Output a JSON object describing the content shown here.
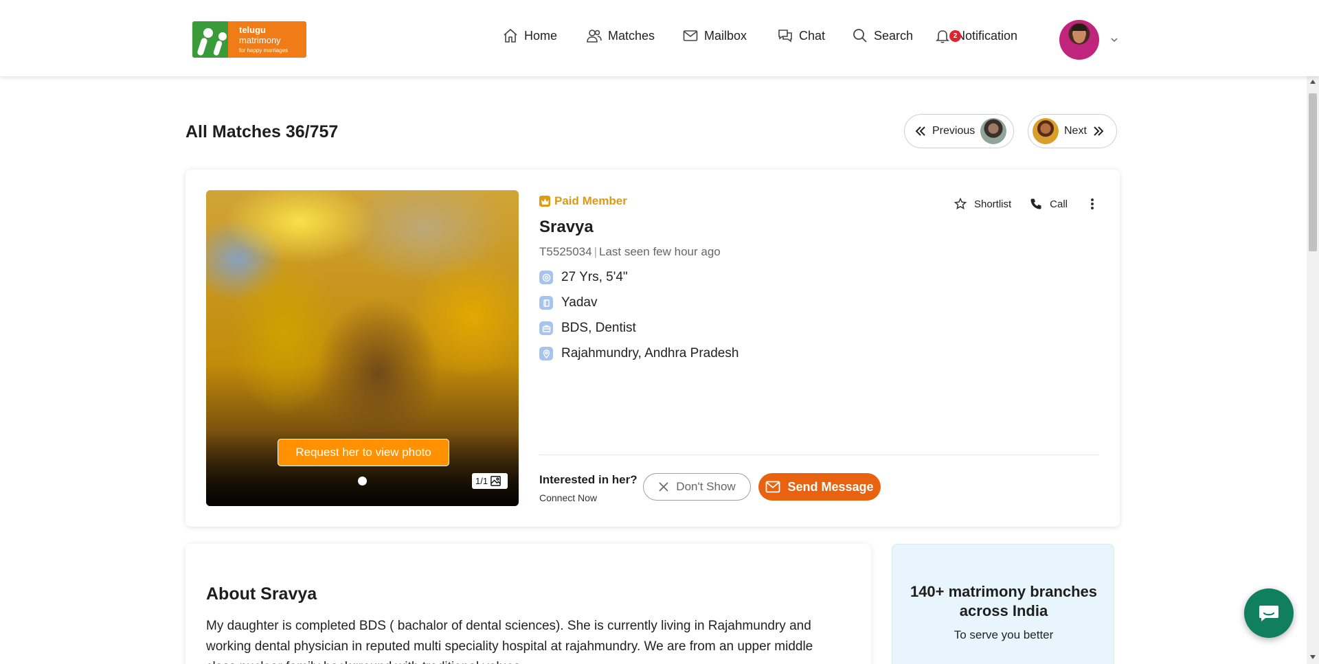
{
  "logo": {
    "line1": "telugu",
    "line2": "matrimony",
    "tagline": "for happy marriages"
  },
  "nav": {
    "home": "Home",
    "matches": "Matches",
    "mailbox": "Mailbox",
    "chat": "Chat",
    "search": "Search",
    "notification": "Notification",
    "notification_count": "2"
  },
  "page": {
    "title": "All Matches 36/757"
  },
  "pager": {
    "previous": "Previous",
    "next": "Next"
  },
  "profile": {
    "member_badge": "Paid Member",
    "name": "Sravya",
    "id": "T5525034",
    "last_seen": "Last seen few hour ago",
    "details": [
      "27 Yrs, 5'4\"",
      "Yadav",
      "BDS, Dentist",
      "Rajahmundry, Andhra Pradesh"
    ],
    "photo_request": "Request her to view photo",
    "photo_count": "1/1",
    "actions": {
      "shortlist": "Shortlist",
      "call": "Call"
    },
    "interested": "Interested in her?",
    "connect": "Connect Now",
    "dont_show": "Don't Show",
    "send_message": "Send Message"
  },
  "about": {
    "title": "About Sravya",
    "text": "My daughter is completed BDS ( bachalor of dental sciences). She is currently living in Rajahmundry and working dental physician in reputed multi speciality hospital at rajahmundry. We are from an upper middle class nuclear family background with traditional values."
  },
  "branches": {
    "title": "140+ matrimony branches across India",
    "subtitle": "To serve you better"
  },
  "colors": {
    "accent": "#e8620f",
    "paid": "#e09a10",
    "brand_green": "#3a9b3a",
    "brand_orange": "#f07c17",
    "fab": "#0f7f5e"
  }
}
